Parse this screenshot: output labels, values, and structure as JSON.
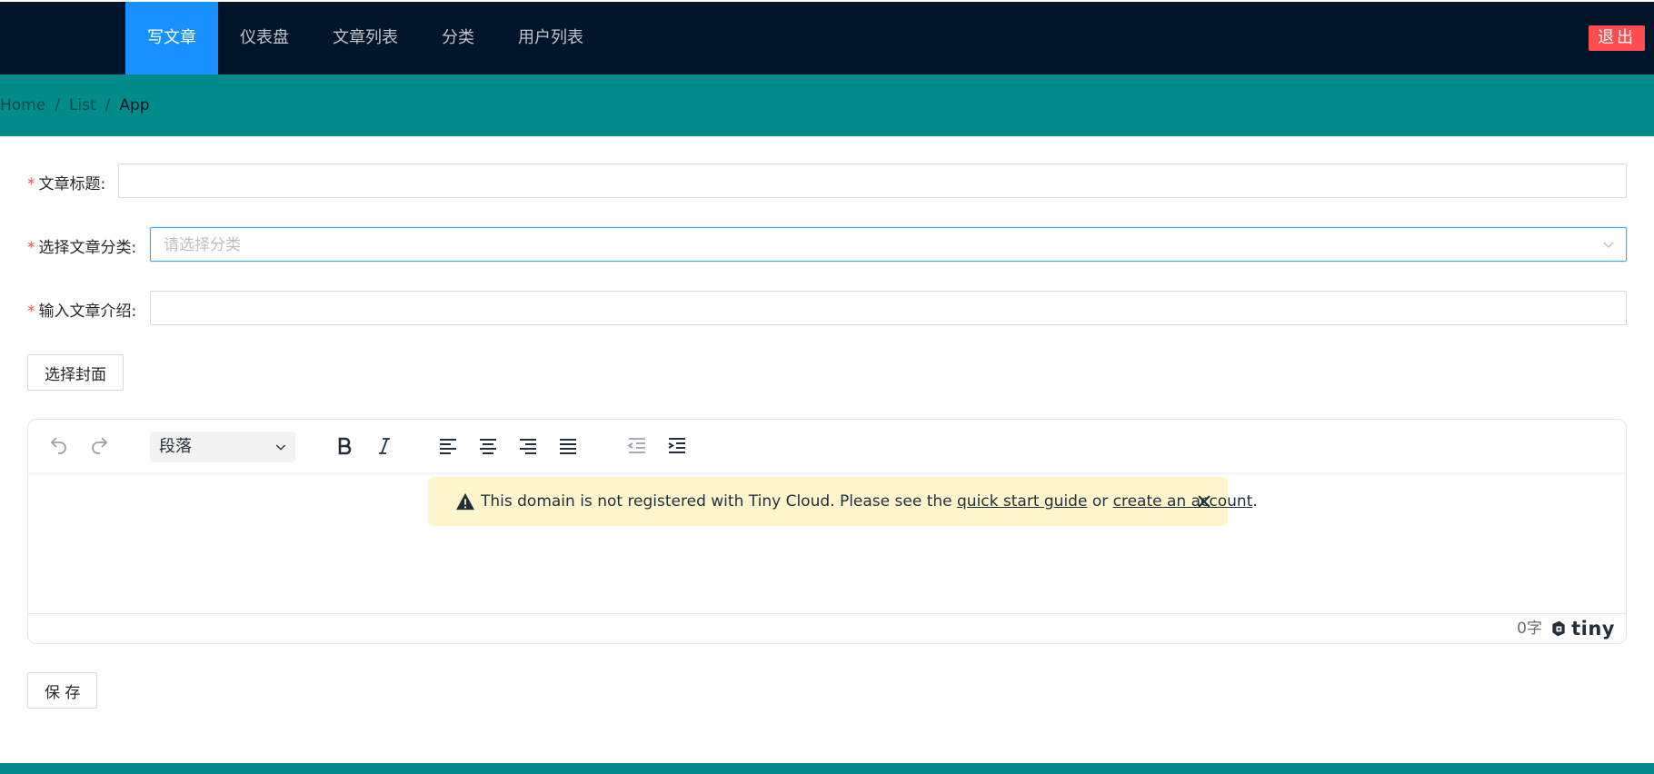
{
  "header": {
    "nav": [
      {
        "label": "写文章",
        "active": true
      },
      {
        "label": "仪表盘"
      },
      {
        "label": "文章列表"
      },
      {
        "label": "分类"
      },
      {
        "label": "用户列表"
      }
    ],
    "logout_label": "退出"
  },
  "breadcrumb": {
    "items": [
      "Home",
      "List",
      "App"
    ],
    "separator": "/"
  },
  "form": {
    "title_label": "文章标题:",
    "title_value": "",
    "category_label": "选择文章分类:",
    "category_placeholder": "请选择分类",
    "intro_label": "输入文章介绍:",
    "intro_value": "",
    "required_mark": "*",
    "cover_button": "选择封面",
    "save_button": "保 存"
  },
  "editor": {
    "block_format": "段落",
    "notice": {
      "text_before": "This domain is not registered with Tiny Cloud. Please see the ",
      "link1": "quick start guide",
      "text_middle": " or ",
      "link2": "create an account",
      "text_after": "."
    },
    "word_count": "0字",
    "brand": "tiny"
  },
  "colors": {
    "header_bg": "#001529",
    "active_nav": "#1890ff",
    "teal": "#008b8b",
    "danger": "#ff4d4f",
    "notice_bg": "#fff5cc"
  },
  "icons": [
    "undo-icon",
    "redo-icon",
    "chevron-down-icon",
    "bold-icon",
    "italic-icon",
    "align-left-icon",
    "align-center-icon",
    "align-right-icon",
    "align-justify-icon",
    "outdent-icon",
    "indent-icon",
    "warning-icon",
    "close-icon",
    "tiny-logo-icon"
  ]
}
